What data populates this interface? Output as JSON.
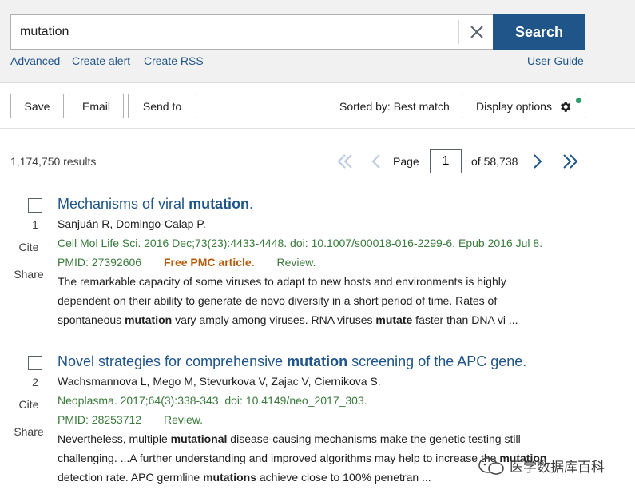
{
  "search": {
    "query": "mutation",
    "button_label": "Search"
  },
  "links": {
    "advanced": "Advanced",
    "create_alert": "Create alert",
    "create_rss": "Create RSS",
    "user_guide": "User Guide"
  },
  "toolbar": {
    "save": "Save",
    "email": "Email",
    "send_to": "Send to",
    "sorted_by": "Sorted by: Best match",
    "display_options": "Display options",
    "status_dot_color": "#2e9e6b"
  },
  "pagination": {
    "results_count": "1,174,750 results",
    "page_label": "Page",
    "page_value": "1",
    "of_label": "of 58,738"
  },
  "results": [
    {
      "number": "1",
      "cite": "Cite",
      "share": "Share",
      "title_pre": "Mechanisms of viral ",
      "title_bold": "mutation",
      "title_post": ".",
      "authors": "Sanjuán R, Domingo-Calap P.",
      "citation": "Cell Mol Life Sci. 2016 Dec;73(23):4433-4448. doi: 10.1007/s00018-016-2299-6. Epub 2016 Jul 8.",
      "pmid": "PMID: 27392606",
      "free_pmc": "Free PMC article.",
      "review": "Review.",
      "snippet": [
        "The remarkable capacity of some viruses to adapt to new hosts and environments is highly",
        "dependent on their ability to generate de novo diversity in a short period of time. Rates of"
      ],
      "snippet_last": {
        "a": "spontaneous ",
        "b": "mutation",
        "c": " vary amply among viruses. RNA viruses ",
        "d": "mutate",
        "e": " faster than DNA vi ..."
      }
    },
    {
      "number": "2",
      "cite": "Cite",
      "share": "Share",
      "title_pre": "Novel strategies for comprehensive ",
      "title_bold": "mutation",
      "title_post": " screening of the APC gene.",
      "authors": "Wachsmannova L, Mego M, Stevurkova V, Zajac V, Ciernikova S.",
      "citation": "Neoplasma. 2017;64(3):338-343. doi: 10.4149/neo_2017_303.",
      "pmid": "PMID: 28253712",
      "review": "Review.",
      "snippet_l1": {
        "a": "Nevertheless, multiple ",
        "b": "mutational",
        "c": " disease-causing mechanisms make the genetic testing still"
      },
      "snippet_l2": {
        "a": "challenging. ...A further understanding and improved algorithms may help to increase the ",
        "b": "mutation"
      },
      "snippet_l3": {
        "a": "detection rate. APC germline ",
        "b": "mutations",
        "c": " achieve close to 100% penetran ..."
      }
    }
  ],
  "watermark": {
    "text": "医学数据库百科"
  }
}
